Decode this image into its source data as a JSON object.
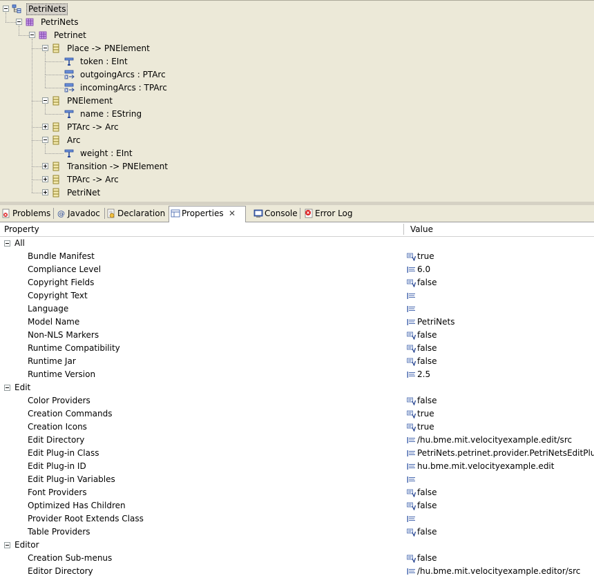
{
  "tree": {
    "nodes": [
      {
        "label": "PetriNets",
        "level": 0,
        "icon": "model-root-icon",
        "toggle": "open",
        "selected": true
      },
      {
        "label": "PetriNets",
        "level": 1,
        "icon": "epackage-icon",
        "toggle": "open"
      },
      {
        "label": "Petrinet",
        "level": 2,
        "icon": "epackage-icon",
        "toggle": "open"
      },
      {
        "label": "Place -> PNElement",
        "level": 3,
        "icon": "eclass-icon",
        "toggle": "open"
      },
      {
        "label": "token : EInt",
        "level": 4,
        "icon": "eattribute-icon",
        "toggle": "none"
      },
      {
        "label": "outgoingArcs : PTArc",
        "level": 4,
        "icon": "ereference-icon",
        "toggle": "none"
      },
      {
        "label": "incomingArcs : TPArc",
        "level": 4,
        "icon": "ereference-icon",
        "toggle": "none"
      },
      {
        "label": "PNElement",
        "level": 3,
        "icon": "eclass-icon",
        "toggle": "open"
      },
      {
        "label": "name : EString",
        "level": 4,
        "icon": "eattribute-icon",
        "toggle": "none"
      },
      {
        "label": "PTArc -> Arc",
        "level": 3,
        "icon": "eclass-icon",
        "toggle": "closed"
      },
      {
        "label": "Arc",
        "level": 3,
        "icon": "eclass-icon",
        "toggle": "open"
      },
      {
        "label": "weight : EInt",
        "level": 4,
        "icon": "eattribute-icon",
        "toggle": "none"
      },
      {
        "label": "Transition -> PNElement",
        "level": 3,
        "icon": "eclass-icon",
        "toggle": "closed"
      },
      {
        "label": "TPArc -> Arc",
        "level": 3,
        "icon": "eclass-icon",
        "toggle": "closed"
      },
      {
        "label": "PetriNet",
        "level": 3,
        "icon": "eclass-icon",
        "toggle": "closed"
      }
    ]
  },
  "tabs": [
    {
      "label": "Problems",
      "icon": "problems-icon",
      "active": false
    },
    {
      "label": "Javadoc",
      "icon": "javadoc-icon",
      "active": false
    },
    {
      "label": "Declaration",
      "icon": "declaration-icon",
      "active": false
    },
    {
      "label": "Properties",
      "icon": "properties-icon",
      "active": true,
      "close": "✕"
    },
    {
      "label": "Console",
      "icon": "console-icon",
      "active": false
    },
    {
      "label": "Error Log",
      "icon": "error-log-icon",
      "active": false
    }
  ],
  "properties": {
    "col_property": "Property",
    "col_value": "Value",
    "rows": [
      {
        "type": "category",
        "label": "All"
      },
      {
        "type": "prop",
        "name": "Bundle Manifest",
        "value": "true",
        "icon": "boolean-icon"
      },
      {
        "type": "prop",
        "name": "Compliance Level",
        "value": "6.0",
        "icon": "text-value-icon"
      },
      {
        "type": "prop",
        "name": "Copyright Fields",
        "value": "false",
        "icon": "boolean-icon"
      },
      {
        "type": "prop",
        "name": "Copyright Text",
        "value": "",
        "icon": "text-value-icon"
      },
      {
        "type": "prop",
        "name": "Language",
        "value": "",
        "icon": "text-value-icon"
      },
      {
        "type": "prop",
        "name": "Model Name",
        "value": "PetriNets",
        "icon": "text-value-icon"
      },
      {
        "type": "prop",
        "name": "Non-NLS Markers",
        "value": "false",
        "icon": "boolean-icon"
      },
      {
        "type": "prop",
        "name": "Runtime Compatibility",
        "value": "false",
        "icon": "boolean-icon"
      },
      {
        "type": "prop",
        "name": "Runtime Jar",
        "value": "false",
        "icon": "boolean-icon"
      },
      {
        "type": "prop",
        "name": "Runtime Version",
        "value": "2.5",
        "icon": "text-value-icon"
      },
      {
        "type": "category",
        "label": "Edit"
      },
      {
        "type": "prop",
        "name": "Color Providers",
        "value": "false",
        "icon": "boolean-icon"
      },
      {
        "type": "prop",
        "name": "Creation Commands",
        "value": "true",
        "icon": "boolean-icon"
      },
      {
        "type": "prop",
        "name": "Creation Icons",
        "value": "true",
        "icon": "boolean-icon"
      },
      {
        "type": "prop",
        "name": "Edit Directory",
        "value": "/hu.bme.mit.velocityexample.edit/src",
        "icon": "text-value-icon"
      },
      {
        "type": "prop",
        "name": "Edit Plug-in Class",
        "value": "PetriNets.petrinet.provider.PetriNetsEditPlugin",
        "icon": "text-value-icon"
      },
      {
        "type": "prop",
        "name": "Edit Plug-in ID",
        "value": "hu.bme.mit.velocityexample.edit",
        "icon": "text-value-icon"
      },
      {
        "type": "prop",
        "name": "Edit Plug-in Variables",
        "value": "",
        "icon": "text-value-icon"
      },
      {
        "type": "prop",
        "name": "Font Providers",
        "value": "false",
        "icon": "boolean-icon"
      },
      {
        "type": "prop",
        "name": "Optimized Has Children",
        "value": "false",
        "icon": "boolean-icon"
      },
      {
        "type": "prop",
        "name": "Provider Root Extends Class",
        "value": "",
        "icon": "text-value-icon"
      },
      {
        "type": "prop",
        "name": "Table Providers",
        "value": "false",
        "icon": "boolean-icon"
      },
      {
        "type": "category",
        "label": "Editor"
      },
      {
        "type": "prop",
        "name": "Creation Sub-menus",
        "value": "false",
        "icon": "boolean-icon"
      },
      {
        "type": "prop",
        "name": "Editor Directory",
        "value": "/hu.bme.mit.velocityexample.editor/src",
        "icon": "text-value-icon"
      }
    ]
  }
}
